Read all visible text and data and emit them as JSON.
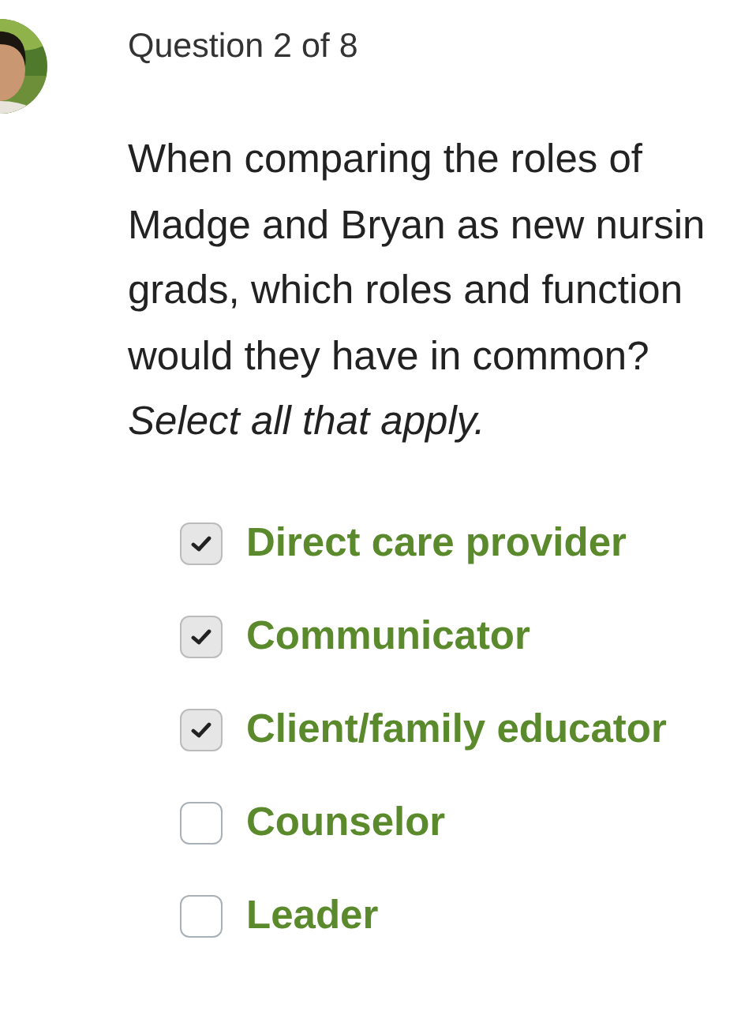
{
  "header": {
    "progress": "Question 2 of 8"
  },
  "question": {
    "lines": [
      "When comparing the roles of",
      "Madge and Bryan as new nursin",
      "grads, which roles and function",
      "would they have in common?"
    ],
    "instruction": "Select all that apply."
  },
  "options": [
    {
      "label": "Direct care provider",
      "checked": true
    },
    {
      "label": "Communicator",
      "checked": true
    },
    {
      "label": "Client/family educator",
      "checked": true
    },
    {
      "label": "Counselor",
      "checked": false
    },
    {
      "label": "Leader",
      "checked": false
    }
  ]
}
